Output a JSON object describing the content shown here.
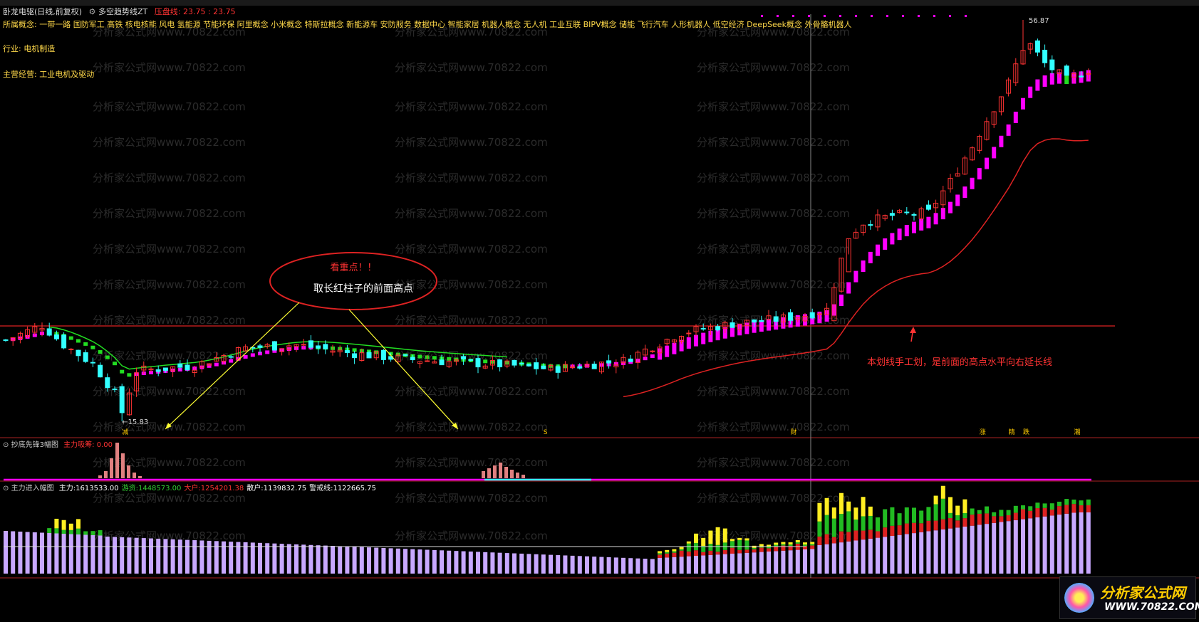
{
  "window": {
    "stock_name": "卧龙电驱(日线,前复权)",
    "indicator_name": "多空趋势线ZT",
    "pressure_label": "压盘线:",
    "pressure_value": "23.75 : 23.75"
  },
  "info_lines": {
    "concepts": "所属概念: 一带一路 国防军工 高铁 核电核能 风电 氢能源 节能环保 阿里概念 小米概念 特斯拉概念 新能源车 安防服务 数据中心 智能家居 机器人概念 无人机 工业互联 BIPV概念 储能 飞行汽车 人形机器人 低空经济 DeepSeek概念 外骨骼机器人",
    "industry": "行业: 电机制造",
    "business": "主营经营: 工业电机及驱动"
  },
  "watermark": "分析家公式网www.70822.com",
  "chart_data": {
    "type": "candlestick",
    "price_high_label": "56.87",
    "price_low_label": "←15.83",
    "reference_line": 23.75,
    "markers": [
      "减",
      "S",
      "财",
      "涨",
      "精",
      "跌",
      "潮"
    ]
  },
  "annotations": {
    "bubble_title": "看重点！！",
    "bubble_text": "取长红柱子的前面高点",
    "right_note": "本划线手工划，是前面的高点水平向右延长线"
  },
  "panel2": {
    "name": "抄底先锋3幅图",
    "label": "主力吸筹:",
    "value": "0.00"
  },
  "panel3": {
    "name": "主力进入幅图",
    "items": [
      {
        "label": "主力:",
        "value": "1613533.00",
        "color": "#ffffff"
      },
      {
        "label": "游资:",
        "value": "1448573.00",
        "color": "#33cc33"
      },
      {
        "label": "大户:",
        "value": "1254201.38",
        "color": "#ff3333"
      },
      {
        "label": "散户:",
        "value": "1139832.75",
        "color": "#ffffff"
      },
      {
        "label": "警戒线:",
        "value": "1122665.75",
        "color": "#ffffff"
      }
    ]
  },
  "logo": {
    "title": "分析家公式网",
    "url": "WWW.70822.COM"
  },
  "colors": {
    "up": "#ff3333",
    "down": "#33ffff",
    "trend_up": "#ff00ff",
    "trend_down": "#22dd22",
    "red_line": "#dd2222",
    "yellow": "#ffff33"
  }
}
